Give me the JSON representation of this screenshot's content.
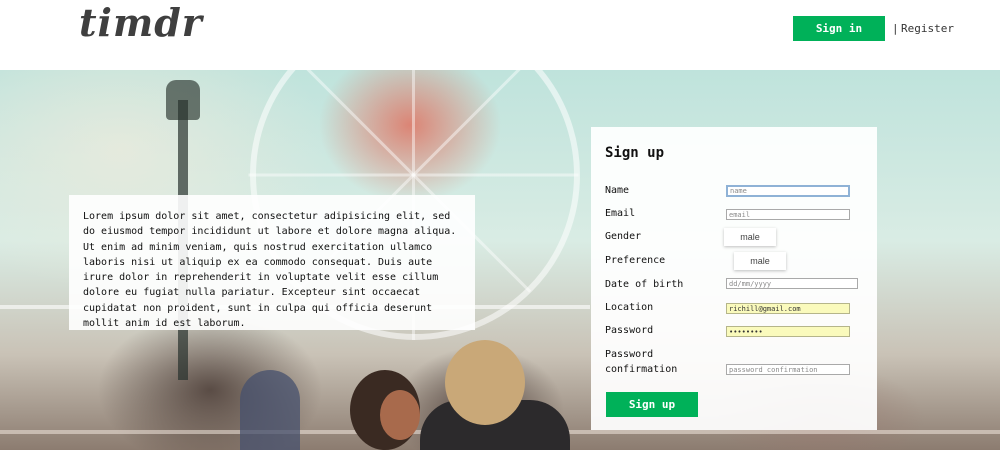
{
  "header": {
    "logo": "timdr",
    "signin_label": "Sign in",
    "divider": "|",
    "register_label": "Register"
  },
  "info": {
    "text": "Lorem ipsum dolor sit amet, consectetur adipisicing elit, sed do eiusmod tempor incididunt ut labore et dolore magna aliqua. Ut enim ad minim veniam, quis nostrud exercitation ullamco laboris nisi ut aliquip ex ea commodo consequat. Duis aute irure dolor in reprehenderit in voluptate velit esse cillum dolore eu fugiat nulla pariatur. Excepteur sint occaecat cupidatat non proident, sunt in culpa qui officia deserunt mollit anim id est laborum."
  },
  "signup": {
    "title": "Sign up",
    "name_label": "Name",
    "name_placeholder": "name",
    "email_label": "Email",
    "email_placeholder": "email",
    "gender_label": "Gender",
    "gender_value": "male",
    "preference_label": "Preference",
    "preference_value": "male",
    "dob_label": "Date of birth",
    "dob_placeholder": "dd/mm/yyyy",
    "location_label": "Location",
    "location_value": "richill@gmail.com",
    "password_label": "Password",
    "password_value": "••••••••",
    "password_confirm_label": "Password confirmation",
    "password_confirm_placeholder": "password confirmation",
    "submit_label": "Sign up"
  },
  "colors": {
    "accent": "#00b159",
    "autofill": "#fafabc",
    "focus": "#8fb2d6"
  }
}
